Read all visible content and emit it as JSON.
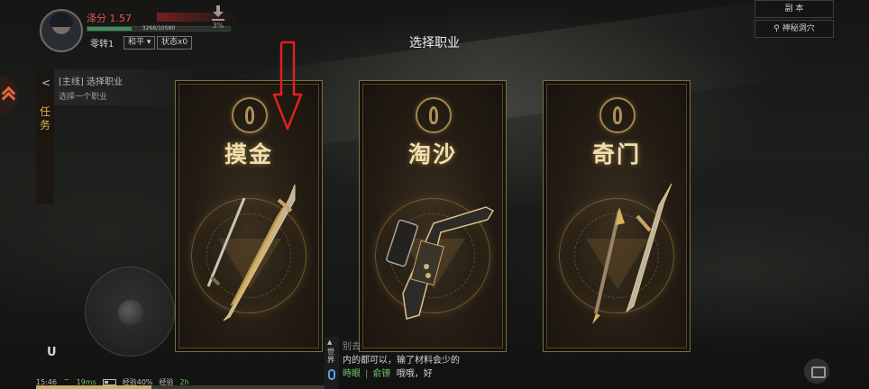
{
  "player": {
    "name": "泽分 1.57",
    "xp_text": "3268/10580",
    "xp_fraction": 0.31,
    "level": "零转1",
    "mode": "和平",
    "status": "状态x0"
  },
  "download": {
    "percent": "3%"
  },
  "title": "选择职业",
  "top_right": {
    "dungeon_label": "副 本",
    "location": "神秘洞穴"
  },
  "quest": {
    "tab_label": "任务",
    "line1": "[主线] 选择职业",
    "line2": "选择一个职业"
  },
  "classes": [
    {
      "name": "摸金",
      "emblem": "flame-emblem-icon",
      "weapon": "greatsword-icon"
    },
    {
      "name": "淘沙",
      "emblem": "axe-emblem-icon",
      "weapon": "gun-icon"
    },
    {
      "name": "奇门",
      "emblem": "spade-emblem-icon",
      "weapon": "spear-icon"
    }
  ],
  "overlay": {
    "arrow_color": "#e02020"
  },
  "bottom_left": {
    "ub_label": "U",
    "status": {
      "time": "15:46",
      "ping": "19ms",
      "exp": "经验40%",
      "extra": "经验",
      "extra_green": "2h"
    }
  },
  "chat": {
    "channel": "世界",
    "line1": "别去",
    "line2": "内的都可以，输了材料会少的",
    "line3_name1": "時眼",
    "line3_sep": "|",
    "line3_name2": "俞镣",
    "line3_text": "哦哦，好"
  }
}
